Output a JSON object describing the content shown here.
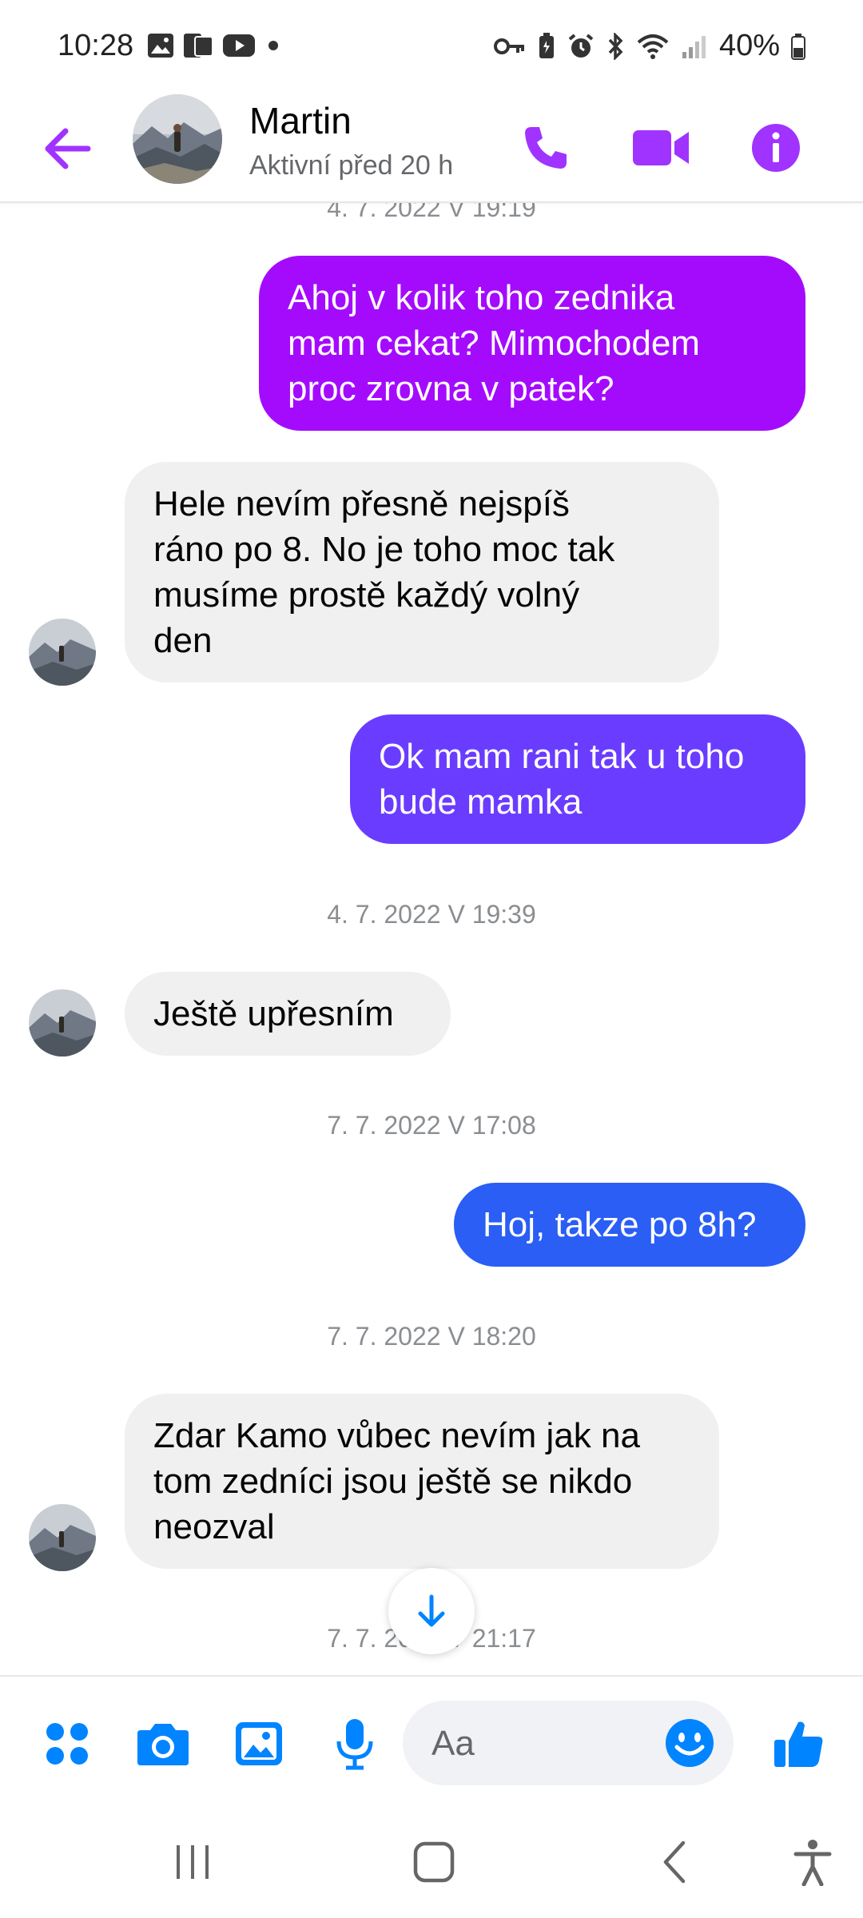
{
  "status_bar": {
    "time": "10:28",
    "battery": "40%"
  },
  "header": {
    "contact_name": "Martin",
    "contact_status": "Aktivní před 20 h"
  },
  "colors": {
    "accent": "#a033ff",
    "messenger_blue": "#0084ff",
    "bubble_gradient_top": "#a40bfd",
    "bubble_gradient_mid": "#6a3cff",
    "bubble_gradient_bottom": "#2a5ef5",
    "incoming_bubble": "#f0f0f0"
  },
  "thread": {
    "timestamp_partial": "4. 7. 2022 V 19:19",
    "messages": [
      {
        "direction": "outgoing",
        "text": "Ahoj v kolik toho zednika\nmam cekat? Mimochodem\nproc zrovna v patek?"
      },
      {
        "direction": "incoming",
        "text": "Hele nevím přesně nejspíš\nráno po 8. No je toho moc tak\nmusíme prostě každý volný\nden"
      },
      {
        "direction": "outgoing",
        "text": "Ok mam rani tak u toho\nbude mamka"
      },
      {
        "direction": "timestamp",
        "text": "4. 7. 2022 V 19:39"
      },
      {
        "direction": "incoming",
        "text": "Ještě upřesním"
      },
      {
        "direction": "timestamp",
        "text": "7. 7. 2022 V 17:08"
      },
      {
        "direction": "outgoing",
        "text": "Hoj, takze po 8h?"
      },
      {
        "direction": "timestamp",
        "text": "7. 7. 2022 V 18:20"
      },
      {
        "direction": "incoming",
        "text": "Zdar Kamo vůbec nevím jak na\ntom zedníci jsou ještě se nikdo\nneozval"
      },
      {
        "direction": "timestamp",
        "text": "7. 7. 2022 V 21:17"
      }
    ]
  },
  "composer": {
    "placeholder": "Aa"
  },
  "icons": {
    "back": "back-arrow-icon",
    "call": "phone-icon",
    "video": "video-camera-icon",
    "info": "info-icon",
    "apps": "apps-grid-icon",
    "camera": "camera-icon",
    "gallery": "image-gallery-icon",
    "mic": "microphone-icon",
    "emoji": "emoji-icon",
    "like": "thumbs-up-icon",
    "scroll": "arrow-down-icon"
  }
}
